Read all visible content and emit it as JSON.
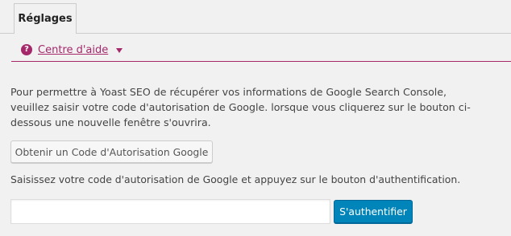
{
  "tabs": [
    {
      "label": "Réglages",
      "active": true
    }
  ],
  "help": {
    "icon": "question-circle-icon",
    "link_label": "Centre d'aide",
    "toggle_icon": "caret-down-icon",
    "accent_color": "#a4286a"
  },
  "main": {
    "description": "Pour permettre à Yoast SEO de récupérer vos informations de Google Search Console, veuillez saisir votre code d'autorisation de Google. lorsque vous cliquerez sur le bouton ci-dessous une nouvelle fenêtre s'ouvrira.",
    "get_code_button_label": "Obtenir un Code d'Autorisation Google",
    "instruction": "Saisissez votre code d'autorisation de Google et appuyez sur le bouton d'authentification.",
    "auth_code_value": "",
    "authenticate_button_label": "S'authentifier",
    "primary_color": "#0085ba"
  }
}
